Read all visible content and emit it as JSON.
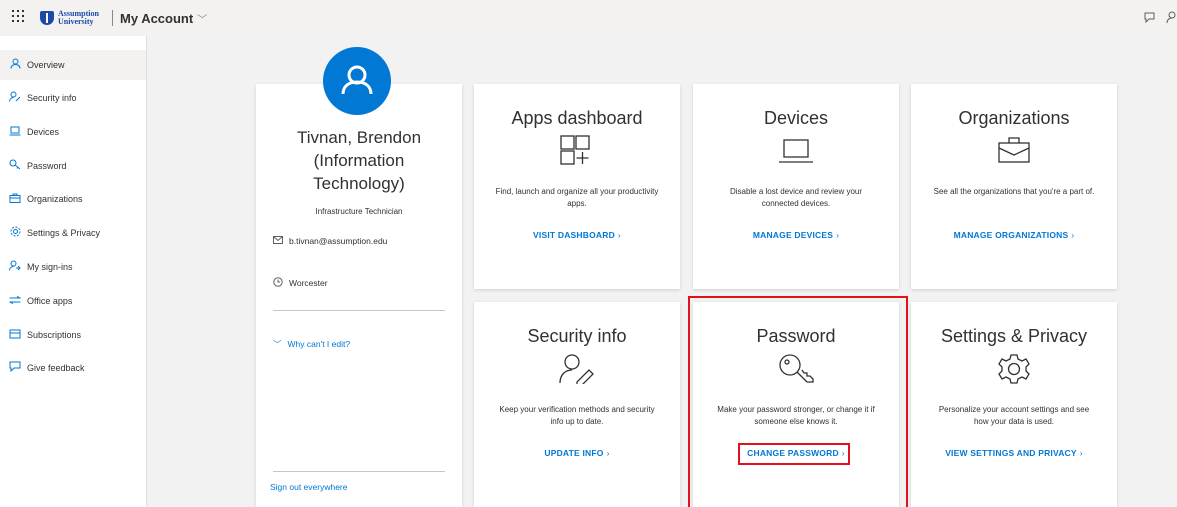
{
  "header": {
    "waffle_icon": "app-launcher-icon",
    "logo_text_line1": "Assumption",
    "logo_text_line2": "University",
    "title": "My Account"
  },
  "sidebar": {
    "items": [
      {
        "label": "Overview",
        "icon": "person-icon",
        "active": true
      },
      {
        "label": "Security info",
        "icon": "security-info-icon"
      },
      {
        "label": "Devices",
        "icon": "laptop-icon"
      },
      {
        "label": "Password",
        "icon": "key-icon"
      },
      {
        "label": "Organizations",
        "icon": "briefcase-icon"
      },
      {
        "label": "Settings & Privacy",
        "icon": "gear-icon"
      },
      {
        "label": "My sign-ins",
        "icon": "sign-ins-icon"
      },
      {
        "label": "Office apps",
        "icon": "office-apps-icon"
      },
      {
        "label": "Subscriptions",
        "icon": "subscriptions-icon"
      },
      {
        "label": "Give feedback",
        "icon": "feedback-icon"
      }
    ]
  },
  "profile": {
    "name_line1": "Tivnan, Brendon",
    "name_line2": "(Information",
    "name_line3": "Technology)",
    "role": "Infrastructure Technician",
    "email": "b.tivnan@assumption.edu",
    "location": "Worcester",
    "why_edit": "Why can't I edit?",
    "sign_out": "Sign out everywhere"
  },
  "cards": {
    "apps": {
      "title": "Apps dashboard",
      "desc_line1": "Find, launch and organize all your productivity",
      "desc_line2": "apps.",
      "link": "VISIT DASHBOARD"
    },
    "devices": {
      "title": "Devices",
      "desc_line1": "Disable a lost device and review your",
      "desc_line2": "connected devices.",
      "link": "MANAGE DEVICES"
    },
    "organizations": {
      "title": "Organizations",
      "desc_line1": "See all the organizations that you're a part of.",
      "desc_line2": "",
      "link": "MANAGE ORGANIZATIONS"
    },
    "security": {
      "title": "Security info",
      "desc_line1": "Keep your verification methods and security",
      "desc_line2": "info up to date.",
      "link": "UPDATE INFO"
    },
    "password": {
      "title": "Password",
      "desc_line1": "Make your password stronger, or change it if",
      "desc_line2": "someone else knows it.",
      "link": "CHANGE PASSWORD"
    },
    "settings": {
      "title": "Settings & Privacy",
      "desc_line1": "Personalize your account settings and see",
      "desc_line2": "how your data is used.",
      "link": "VIEW SETTINGS AND PRIVACY"
    }
  },
  "colors": {
    "accent": "#0078d4",
    "highlight": "#e3101e"
  }
}
